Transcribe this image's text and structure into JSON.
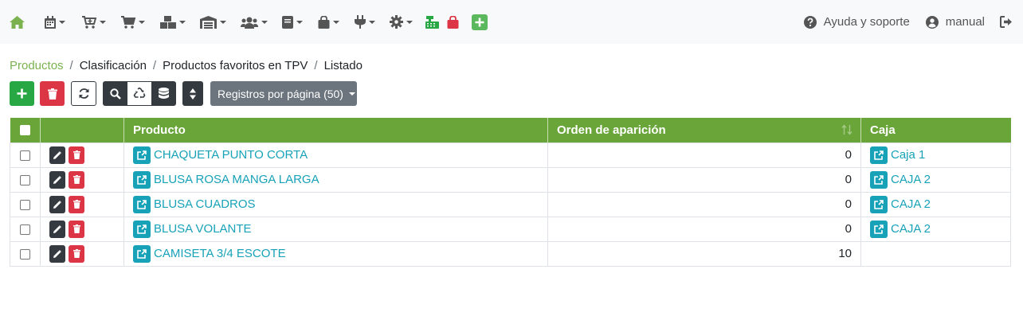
{
  "navbar": {
    "menu_icons": [
      {
        "icon": "home-icon",
        "color": "#7bb24f",
        "dropdown": false
      },
      {
        "icon": "calendar-icon",
        "color": "#555555",
        "dropdown": true
      },
      {
        "icon": "cart-plus-icon",
        "color": "#555555",
        "dropdown": true
      },
      {
        "icon": "cart-icon",
        "color": "#555555",
        "dropdown": true
      },
      {
        "icon": "cubes-icon",
        "color": "#555555",
        "dropdown": true
      },
      {
        "icon": "warehouse-icon",
        "color": "#555555",
        "dropdown": true
      },
      {
        "icon": "users-icon",
        "color": "#555555",
        "dropdown": true
      },
      {
        "icon": "book-icon",
        "color": "#555555",
        "dropdown": true
      },
      {
        "icon": "shopping-bag-icon",
        "color": "#555555",
        "dropdown": true
      },
      {
        "icon": "plug-icon",
        "color": "#555555",
        "dropdown": true
      },
      {
        "icon": "gear-icon",
        "color": "#555555",
        "dropdown": true
      },
      {
        "icon": "cash-register-icon",
        "color": "#28a745",
        "dropdown": false
      },
      {
        "icon": "shopping-bag-icon",
        "color": "#dc3545",
        "dropdown": false
      },
      {
        "icon": "plus-square-icon",
        "color": "#5cb85c",
        "dropdown": false
      }
    ],
    "help_label": "Ayuda y soporte",
    "user_label": "manual"
  },
  "breadcrumb": {
    "items": [
      "Productos",
      "Clasificación",
      "Productos favoritos en TPV",
      "Listado"
    ],
    "separator": "/"
  },
  "toolbar": {
    "records_label": "Registros por página (50)"
  },
  "table": {
    "headers": {
      "product": "Producto",
      "order": "Orden de aparición",
      "cash": "Caja"
    },
    "rows": [
      {
        "product": "CHAQUETA PUNTO CORTA",
        "order": "0",
        "cash": "Caja 1"
      },
      {
        "product": "BLUSA ROSA MANGA LARGA",
        "order": "0",
        "cash": "CAJA 2"
      },
      {
        "product": "BLUSA CUADROS",
        "order": "0",
        "cash": "CAJA 2"
      },
      {
        "product": "BLUSA VOLANTE",
        "order": "0",
        "cash": "CAJA 2"
      },
      {
        "product": "CAMISETA 3/4 ESCOTE",
        "order": "10",
        "cash": ""
      }
    ]
  },
  "colors": {
    "accent_green": "#6aa53a",
    "link_green": "#7bb24f",
    "info_teal": "#17a2b8",
    "danger_red": "#dc3545",
    "success_green": "#28a745",
    "dark": "#343a40",
    "secondary": "#6c757d"
  }
}
